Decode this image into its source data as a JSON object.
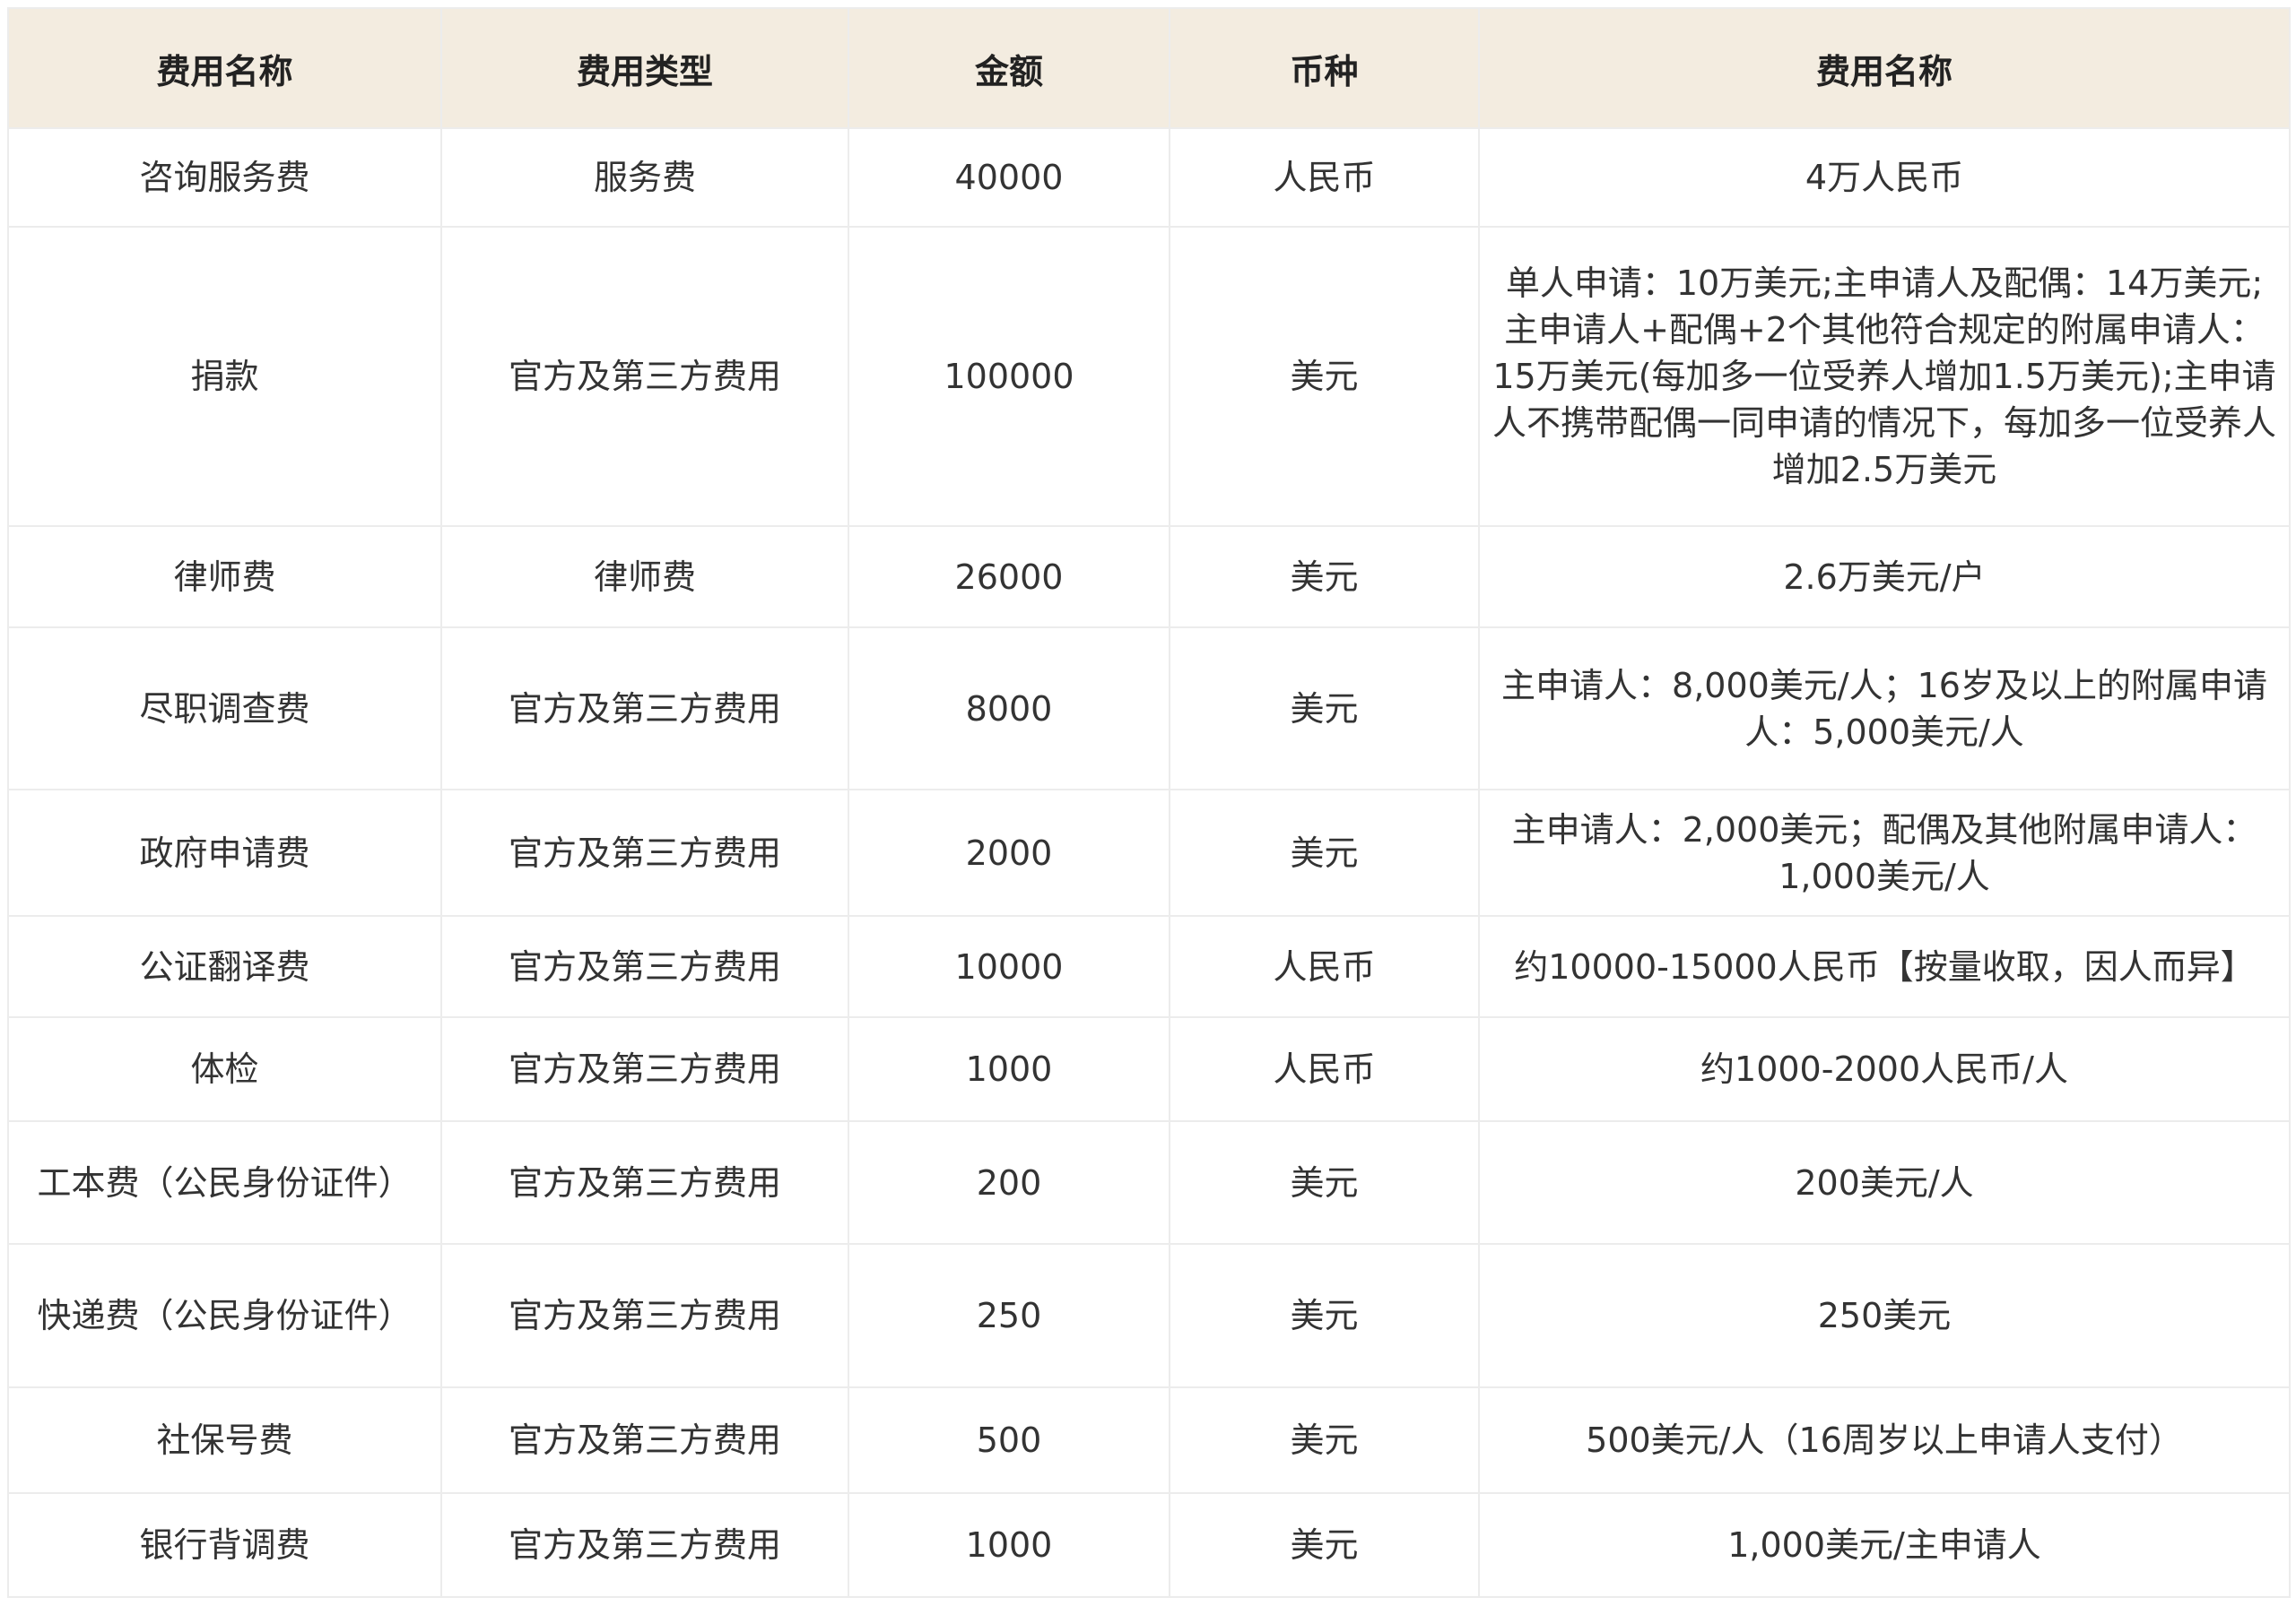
{
  "table": {
    "headers": [
      "费用名称",
      "费用类型",
      "金额",
      "币种",
      "费用名称"
    ],
    "rows": [
      [
        "咨询服务费",
        "服务费",
        "40000",
        "人民币",
        "4万人民币"
      ],
      [
        "捐款",
        "官方及第三方费用",
        "100000",
        "美元",
        "单人申请：10万美元;主申请人及配偶：14万美元;主申请人+配偶+2个其他符合规定的附属申请人：15万美元(每加多一位受养人增加1.5万美元);主申请人不携带配偶一同申请的情况下，每加多一位受养人增加2.5万美元"
      ],
      [
        "律师费",
        "律师费",
        "26000",
        "美元",
        "2.6万美元/户"
      ],
      [
        "尽职调查费",
        "官方及第三方费用",
        "8000",
        "美元",
        "主申请人：8,000美元/人；16岁及以上的附属申请人：5,000美元/人"
      ],
      [
        "政府申请费",
        "官方及第三方费用",
        "2000",
        "美元",
        "主申请人：2,000美元；配偶及其他附属申请人：1,000美元/人"
      ],
      [
        "公证翻译费",
        "官方及第三方费用",
        "10000",
        "人民币",
        "约10000-15000人民币【按量收取，因人而异】"
      ],
      [
        "体检",
        "官方及第三方费用",
        "1000",
        "人民币",
        "约1000-2000人民币/人"
      ],
      [
        "工本费（公民身份证件）",
        "官方及第三方费用",
        "200",
        "美元",
        "200美元/人"
      ],
      [
        "快递费（公民身份证件）",
        "官方及第三方费用",
        "250",
        "美元",
        "250美元"
      ],
      [
        "社保号费",
        "官方及第三方费用",
        "500",
        "美元",
        "500美元/人（16周岁以上申请人支付）"
      ],
      [
        "银行背调费",
        "官方及第三方费用",
        "1000",
        "美元",
        "1,000美元/主申请人"
      ]
    ]
  }
}
